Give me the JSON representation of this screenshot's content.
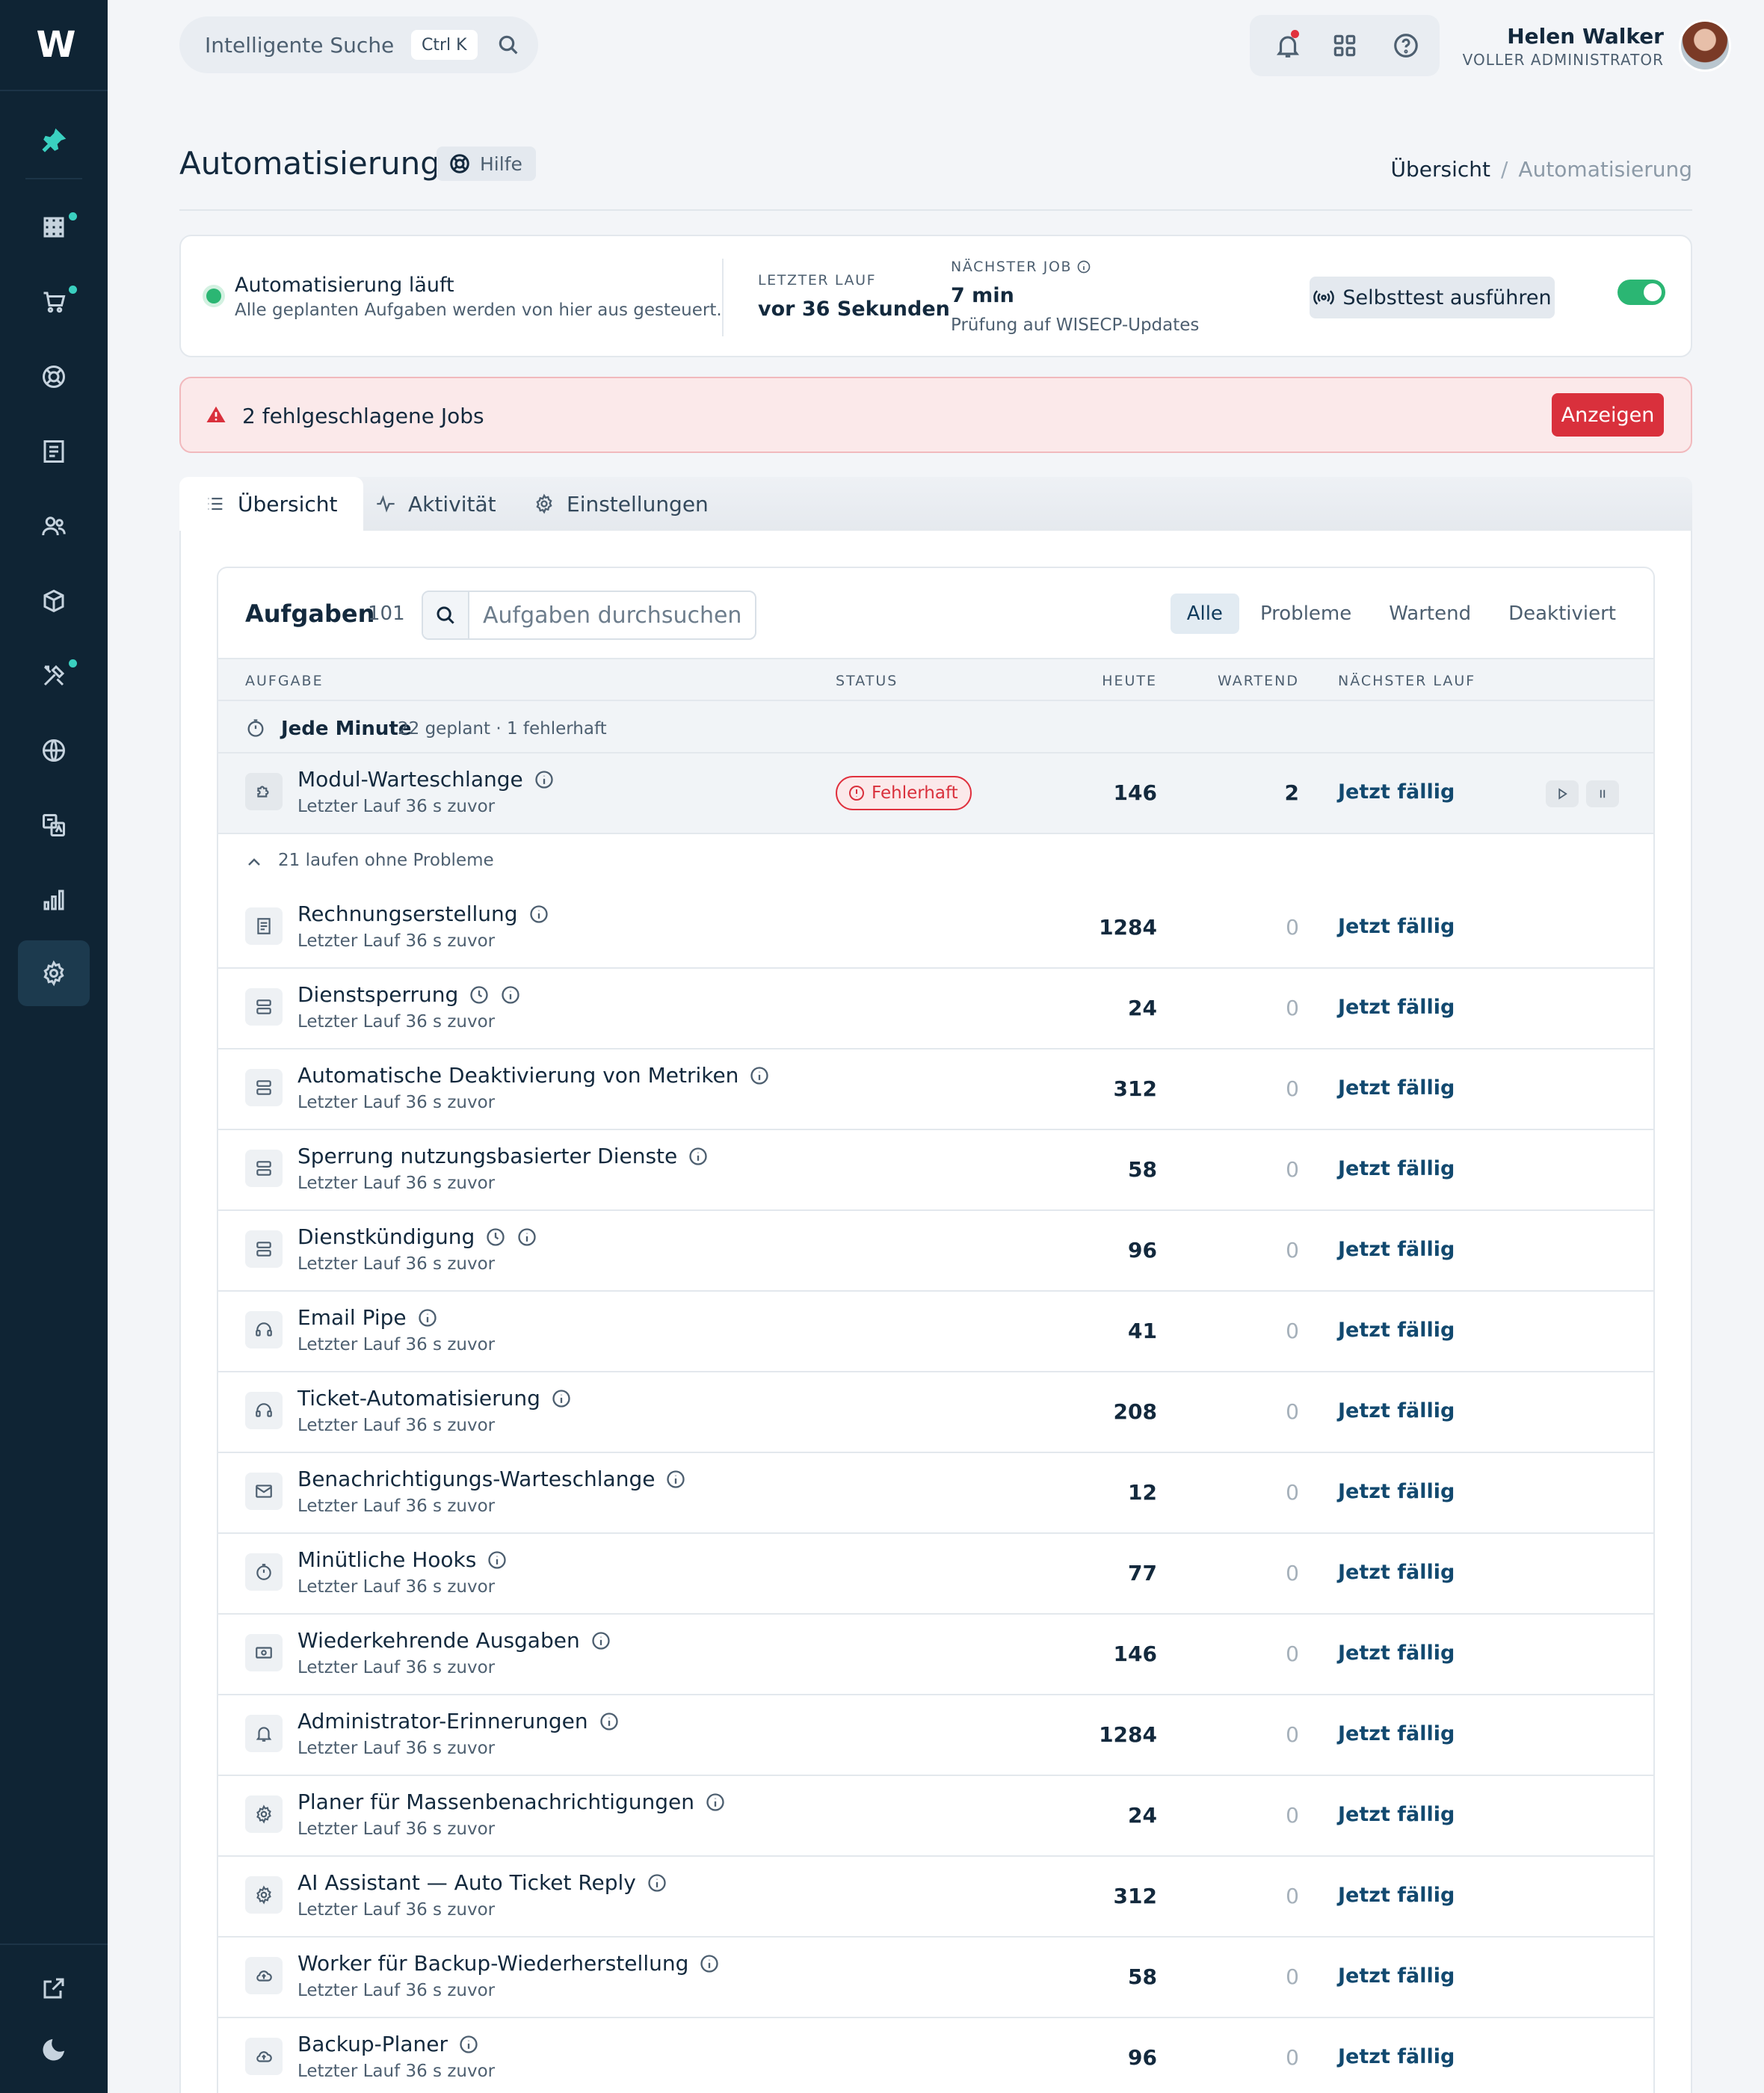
{
  "search": {
    "placeholder": "Intelligente Suche",
    "shortcut": "Ctrl K"
  },
  "user": {
    "name": "Helen Walker",
    "role": "VOLLER ADMINISTRATOR"
  },
  "page": {
    "title": "Automatisierung",
    "help_label": "Hilfe"
  },
  "breadcrumb": {
    "home": "Übersicht",
    "separator": "/",
    "current": "Automatisierung"
  },
  "status": {
    "title": "Automatisierung läuft",
    "subtitle": "Alle geplanten Aufgaben werden von hier aus gesteuert.",
    "last_run_label": "LETZTER LAUF",
    "last_run_value": "vor 36 Sekunden",
    "next_job_label": "NÄCHSTER JOB",
    "next_job_value": "7 min",
    "next_job_sub": "Prüfung auf WISECP-Updates",
    "selftest_label": "Selbsttest ausführen",
    "enabled": true
  },
  "alert": {
    "text": "2 fehlgeschlagene Jobs",
    "button": "Anzeigen"
  },
  "tabs": [
    {
      "label": "Übersicht",
      "icon": "list-icon"
    },
    {
      "label": "Aktivität",
      "icon": "activity-icon"
    },
    {
      "label": "Einstellungen",
      "icon": "gear-icon"
    }
  ],
  "tasks": {
    "title": "Aufgaben",
    "count": "101",
    "search_placeholder": "Aufgaben durchsuchen",
    "filters": [
      "Alle",
      "Probleme",
      "Wartend",
      "Deaktiviert"
    ],
    "columns": [
      "AUFGABE",
      "STATUS",
      "HEUTE",
      "WARTEND",
      "NÄCHSTER LAUF"
    ],
    "group": {
      "title": "Jede Minute",
      "subtitle": "22 geplant · 1 fehlerhaft"
    },
    "failed_row": {
      "name": "Modul-Warteschlange",
      "sub": "Letzter Lauf 36 s zuvor",
      "status": "Fehlerhaft",
      "today": "146",
      "waiting": "2",
      "next": "Jetzt fällig"
    },
    "collapse_label": "21 laufen ohne Probleme",
    "rows": [
      {
        "name": "Rechnungserstellung",
        "sub": "Letzter Lauf 36 s zuvor",
        "today": "1284",
        "waiting": "0",
        "next": "Jetzt fällig",
        "icon": "invoice-icon"
      },
      {
        "name": "Dienstsperrung",
        "sub": "Letzter Lauf 36 s zuvor",
        "today": "24",
        "waiting": "0",
        "next": "Jetzt fällig",
        "icon": "server-icon"
      },
      {
        "name": "Automatische Deaktivierung von Metriken",
        "sub": "Letzter Lauf 36 s zuvor",
        "today": "312",
        "waiting": "0",
        "next": "Jetzt fällig",
        "icon": "server-icon"
      },
      {
        "name": "Sperrung nutzungsbasierter Dienste",
        "sub": "Letzter Lauf 36 s zuvor",
        "today": "58",
        "waiting": "0",
        "next": "Jetzt fällig",
        "icon": "server-icon"
      },
      {
        "name": "Dienstkündigung",
        "sub": "Letzter Lauf 36 s zuvor",
        "today": "96",
        "waiting": "0",
        "next": "Jetzt fällig",
        "icon": "server-icon"
      },
      {
        "name": "Email Pipe",
        "sub": "Letzter Lauf 36 s zuvor",
        "today": "41",
        "waiting": "0",
        "next": "Jetzt fällig",
        "icon": "headset-icon"
      },
      {
        "name": "Ticket-Automatisierung",
        "sub": "Letzter Lauf 36 s zuvor",
        "today": "208",
        "waiting": "0",
        "next": "Jetzt fällig",
        "icon": "headset-icon"
      },
      {
        "name": "Benachrichtigungs-Warteschlange",
        "sub": "Letzter Lauf 36 s zuvor",
        "today": "12",
        "waiting": "0",
        "next": "Jetzt fällig",
        "icon": "mail-icon"
      },
      {
        "name": "Minütliche Hooks",
        "sub": "Letzter Lauf 36 s zuvor",
        "today": "77",
        "waiting": "0",
        "next": "Jetzt fällig",
        "icon": "timer-icon"
      },
      {
        "name": "Wiederkehrende Ausgaben",
        "sub": "Letzter Lauf 36 s zuvor",
        "today": "146",
        "waiting": "0",
        "next": "Jetzt fällig",
        "icon": "cash-icon"
      },
      {
        "name": "Administrator-Erinnerungen",
        "sub": "Letzter Lauf 36 s zuvor",
        "today": "1284",
        "waiting": "0",
        "next": "Jetzt fällig",
        "icon": "bell-icon"
      },
      {
        "name": "Planer für Massenbenachrichtigungen",
        "sub": "Letzter Lauf 36 s zuvor",
        "today": "24",
        "waiting": "0",
        "next": "Jetzt fällig",
        "icon": "gear-icon"
      },
      {
        "name": "AI Assistant — Auto Ticket Reply",
        "sub": "Letzter Lauf 36 s zuvor",
        "today": "312",
        "waiting": "0",
        "next": "Jetzt fällig",
        "icon": "gear-icon"
      },
      {
        "name": "Worker für Backup-Wiederherstellung",
        "sub": "Letzter Lauf 36 s zuvor",
        "today": "58",
        "waiting": "0",
        "next": "Jetzt fällig",
        "icon": "cloud-icon"
      },
      {
        "name": "Backup-Planer",
        "sub": "Letzter Lauf 36 s zuvor",
        "today": "96",
        "waiting": "0",
        "next": "Jetzt fällig",
        "icon": "cloud-icon"
      }
    ]
  },
  "colors": {
    "accent": "#12496f",
    "sidebar": "#0f2434",
    "success": "#2bb673",
    "danger": "#d9303c"
  }
}
